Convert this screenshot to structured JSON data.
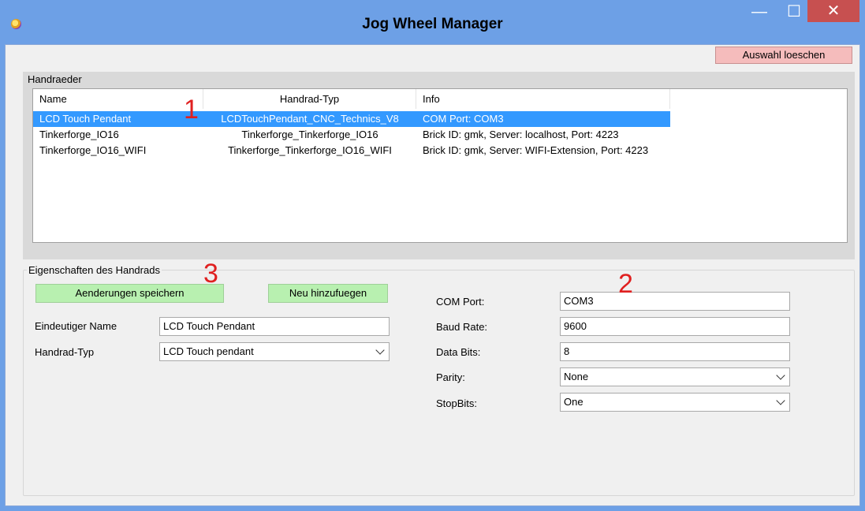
{
  "window": {
    "title": "Jog Wheel Manager",
    "minimize": "—",
    "maximize": "☐",
    "close": "✕"
  },
  "toolbar": {
    "clear_label": "Auswahl loeschen"
  },
  "handwheels": {
    "group_label": "Handraeder",
    "columns": [
      "Name",
      "Handrad-Typ",
      "Info"
    ],
    "rows": [
      {
        "name": "LCD Touch Pendant",
        "type": "LCDTouchPendant_CNC_Technics_V8",
        "info": "COM Port: COM3",
        "selected": true
      },
      {
        "name": "Tinkerforge_IO16",
        "type": "Tinkerforge_Tinkerforge_IO16",
        "info": "Brick ID: gmk, Server: localhost, Port: 4223",
        "selected": false
      },
      {
        "name": "Tinkerforge_IO16_WIFI",
        "type": "Tinkerforge_Tinkerforge_IO16_WIFI",
        "info": "Brick ID: gmk, Server: WIFI-Extension, Port: 4223",
        "selected": false
      }
    ]
  },
  "properties": {
    "group_label": "Eigenschaften des Handrads",
    "save_label": "Aenderungen speichern",
    "add_label": "Neu hinzufuegen",
    "unique_name_label": "Eindeutiger Name",
    "unique_name_value": "LCD Touch Pendant",
    "type_label": "Handrad-Typ",
    "type_value": "LCD Touch pendant",
    "com_port_label": "COM Port:",
    "com_port_value": "COM3",
    "baud_label": "Baud Rate:",
    "baud_value": "9600",
    "databits_label": "Data Bits:",
    "databits_value": "8",
    "parity_label": "Parity:",
    "parity_value": "None",
    "stopbits_label": "StopBits:",
    "stopbits_value": "One"
  },
  "annotations": [
    "1",
    "2",
    "3"
  ],
  "colors": {
    "titlebar": "#6da0e6",
    "selection": "#3399ff",
    "green_button": "#b8f0b0",
    "red_button": "#f5bcbc",
    "annotation": "#e02020"
  }
}
